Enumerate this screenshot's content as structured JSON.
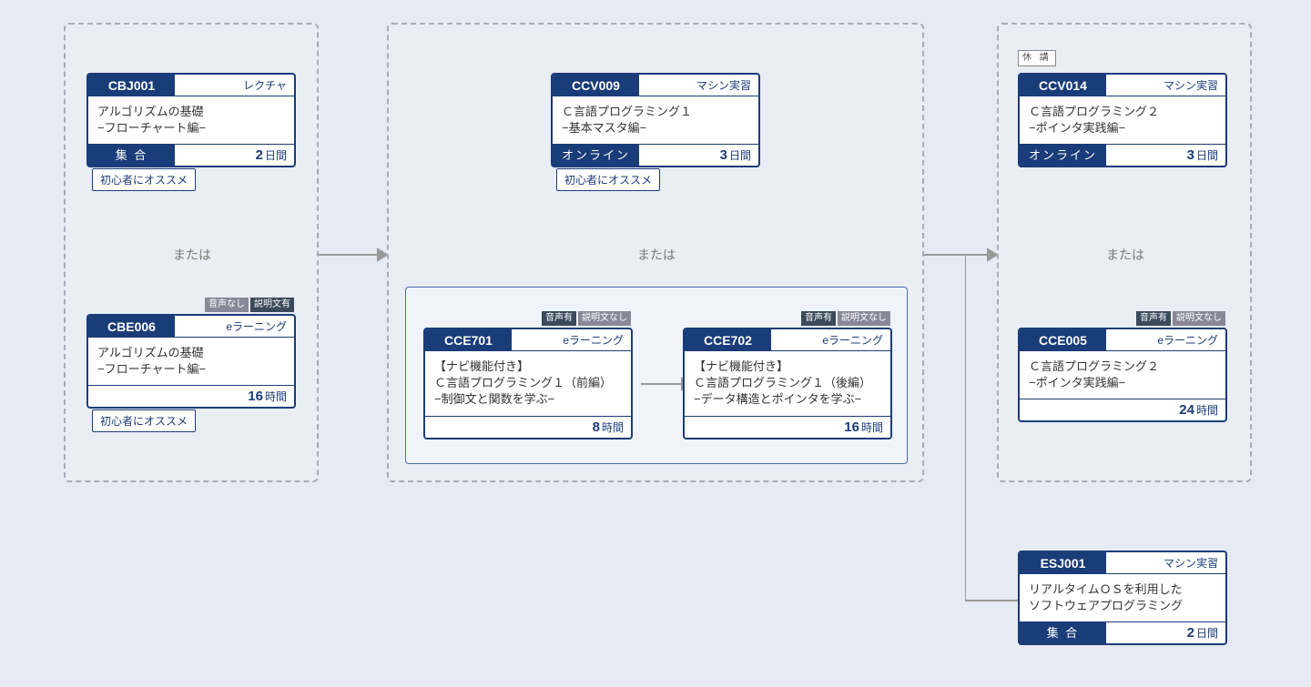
{
  "labels": {
    "or": "または",
    "suspended": "休 講",
    "beginner": "初心者にオススメ",
    "audio_yes": "音声有",
    "audio_no": "音声なし",
    "text_yes": "説明文有",
    "text_no": "説明文なし"
  },
  "cards": {
    "cbj001": {
      "code": "CBJ001",
      "type": "レクチャ",
      "title1": "アルゴリズムの基礎",
      "title2": "−フローチャート編−",
      "mode": "集 合",
      "num": "2",
      "unit": "日間"
    },
    "cbe006": {
      "code": "CBE006",
      "type": "eラーニング",
      "title1": "アルゴリズムの基礎",
      "title2": "−フローチャート編−",
      "mode": "",
      "num": "16",
      "unit": "時間"
    },
    "ccv009": {
      "code": "CCV009",
      "type": "マシン実習",
      "title1": "Ｃ言語プログラミング１",
      "title2": "−基本マスタ編−",
      "mode": "オンライン",
      "num": "3",
      "unit": "日間"
    },
    "cce701": {
      "code": "CCE701",
      "type": "eラーニング",
      "title1": "【ナビ機能付き】",
      "title2": "Ｃ言語プログラミング１（前編）",
      "title3": "−制御文と関数を学ぶ−",
      "mode": "",
      "num": "8",
      "unit": "時間"
    },
    "cce702": {
      "code": "CCE702",
      "type": "eラーニング",
      "title1": "【ナビ機能付き】",
      "title2": "Ｃ言語プログラミング１（後編）",
      "title3": "−データ構造とポインタを学ぶ−",
      "mode": "",
      "num": "16",
      "unit": "時間"
    },
    "ccv014": {
      "code": "CCV014",
      "type": "マシン実習",
      "title1": "Ｃ言語プログラミング２",
      "title2": "−ポインタ実践編−",
      "mode": "オンライン",
      "num": "3",
      "unit": "日間"
    },
    "cce005": {
      "code": "CCE005",
      "type": "eラーニング",
      "title1": "Ｃ言語プログラミング２",
      "title2": "−ポインタ実践編−",
      "mode": "",
      "num": "24",
      "unit": "時間"
    },
    "esj001": {
      "code": "ESJ001",
      "type": "マシン実習",
      "title1": "リアルタイムＯＳを利用した",
      "title2": "ソフトウェアプログラミング",
      "mode": "集 合",
      "num": "2",
      "unit": "日間"
    }
  }
}
